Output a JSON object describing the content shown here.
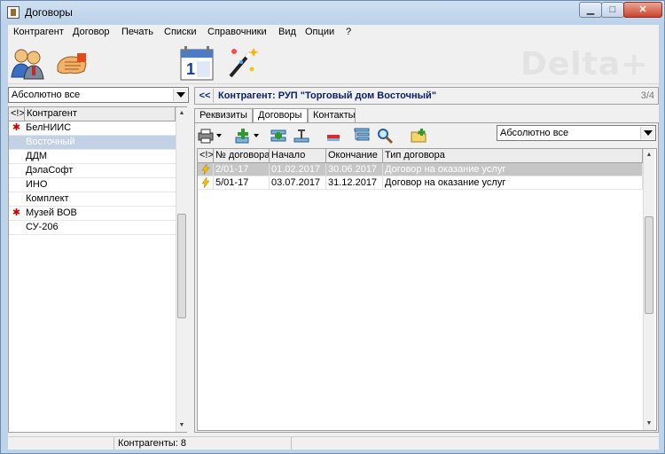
{
  "window": {
    "title": "Договоры",
    "controls": {
      "minimize": "▁",
      "maximize": "□",
      "close": "✕"
    }
  },
  "menu": [
    "Контрагент",
    "Договор",
    "Печать",
    "Списки",
    "Справочники",
    "Вид",
    "Опции",
    "?"
  ],
  "toolbar": {
    "icons": [
      "users-icon",
      "handshake-icon",
      "calendar-icon",
      "magic-wand-icon"
    ],
    "logo": "Delta+"
  },
  "left": {
    "filter_value": "Абсолютно все",
    "headers": [
      "<!>",
      "Контрагент"
    ],
    "rows": [
      {
        "mark": "✱",
        "name": "БелНИИС",
        "selected": false
      },
      {
        "mark": "",
        "name": "Восточный",
        "selected": true
      },
      {
        "mark": "",
        "name": "ДДМ",
        "selected": false
      },
      {
        "mark": "",
        "name": "ДэлаСофт",
        "selected": false
      },
      {
        "mark": "",
        "name": "ИНО",
        "selected": false
      },
      {
        "mark": "",
        "name": "Комплект",
        "selected": false
      },
      {
        "mark": "✱",
        "name": "Музей ВОВ",
        "selected": false
      },
      {
        "mark": "",
        "name": "СУ-206",
        "selected": false
      }
    ]
  },
  "right": {
    "back_label": "<<",
    "title": "Контрагент: РУП \"Торговый дом Восточный\"",
    "counter": "3/4",
    "tabs": [
      {
        "label": "Реквизиты",
        "active": false
      },
      {
        "label": "Договоры",
        "active": true
      },
      {
        "label": "Контакты",
        "active": false
      }
    ],
    "filter_value": "Абсолютно все",
    "toolbar_icons": [
      "printer-icon",
      "add-green-icon",
      "add-row-icon",
      "edit-row-icon",
      "delete-icon",
      "tree-list-icon",
      "search-icon",
      "new-folder-icon"
    ],
    "headers": [
      "<!>",
      "№ договора",
      "Начало",
      "Окончание",
      "Тип договора"
    ],
    "rows": [
      {
        "num": "2/01-17",
        "start": "01.02.2017",
        "end": "30.06.2017",
        "type": "Договор на оказание услуг",
        "selected": true
      },
      {
        "num": "5/01-17",
        "start": "03.07.2017",
        "end": "31.12.2017",
        "type": "Договор на оказание услуг",
        "selected": false
      }
    ]
  },
  "status": {
    "count": "Контрагенты: 8"
  }
}
